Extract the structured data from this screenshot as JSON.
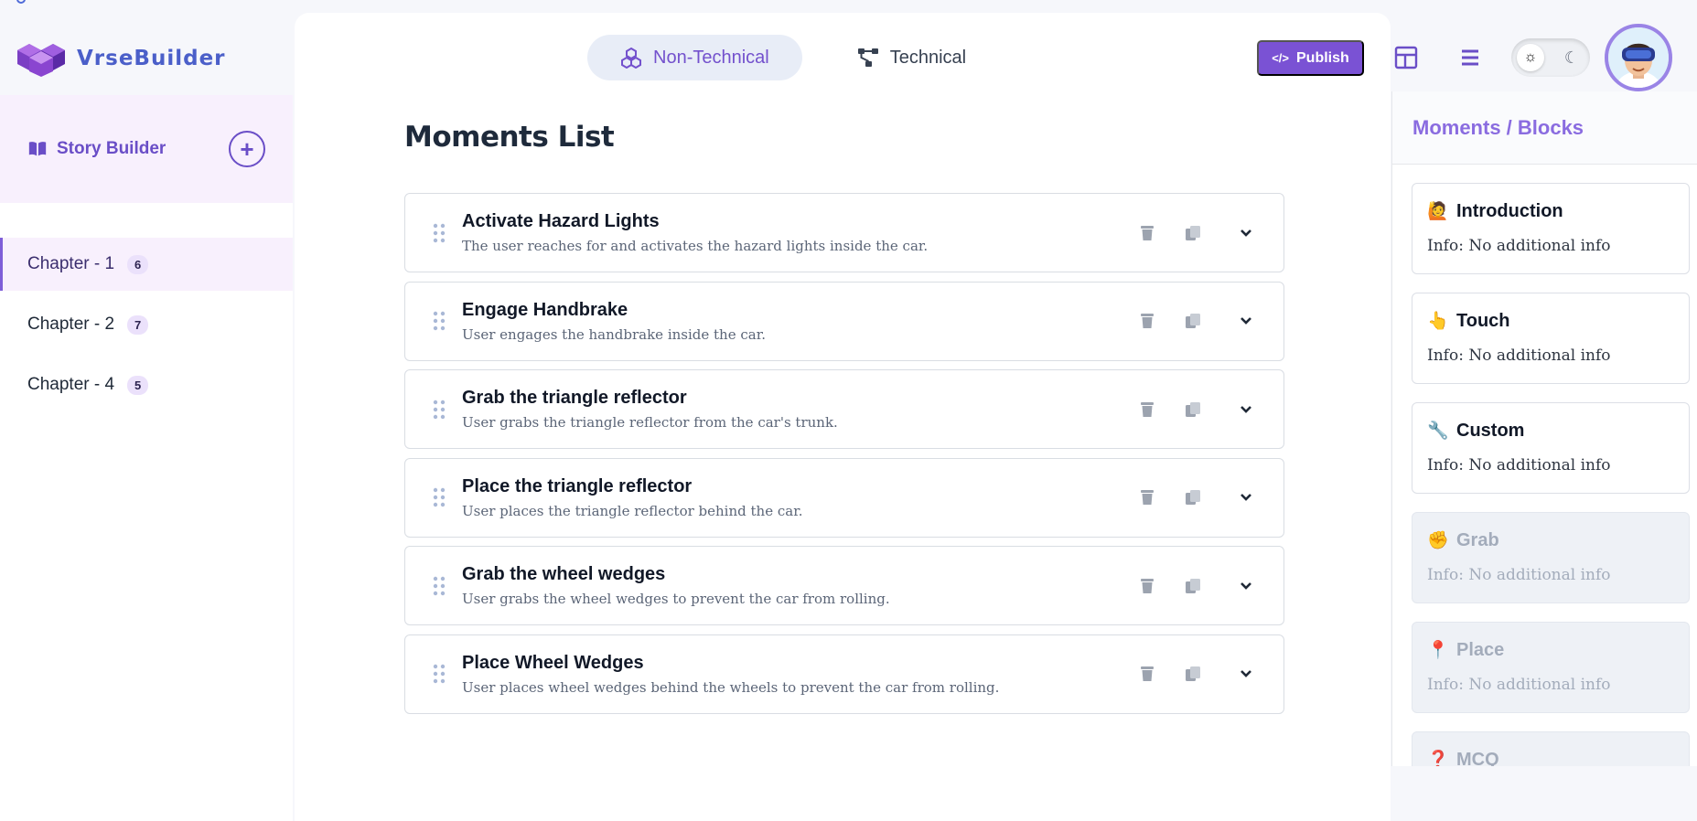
{
  "app": {
    "name": "VrseBuilder"
  },
  "sidebar": {
    "story_title": "Story Builder",
    "add_label": "+",
    "chapters": [
      {
        "label": "Chapter - 1",
        "count": "6",
        "active": true
      },
      {
        "label": "Chapter - 2",
        "count": "7",
        "active": false
      },
      {
        "label": "Chapter - 4",
        "count": "5",
        "active": false
      }
    ]
  },
  "header": {
    "modes": [
      {
        "label": "Non-Technical",
        "active": true
      },
      {
        "label": "Technical",
        "active": false
      }
    ],
    "publish_label": "Publish",
    "theme": {
      "sun": "☼",
      "moon": "☾"
    }
  },
  "main": {
    "title": "Moments List",
    "moments": [
      {
        "title": "Activate Hazard Lights",
        "desc": "The user reaches for and activates the hazard lights inside the car."
      },
      {
        "title": "Engage Handbrake",
        "desc": "User engages the handbrake inside the car."
      },
      {
        "title": "Grab the triangle reflector",
        "desc": "User grabs the triangle reflector from the car's trunk."
      },
      {
        "title": "Place the triangle reflector",
        "desc": "User places the triangle reflector behind the car."
      },
      {
        "title": "Grab the wheel wedges",
        "desc": "User grabs the wheel wedges to prevent the car from rolling."
      },
      {
        "title": "Place Wheel Wedges",
        "desc": "User places wheel wedges behind the wheels to prevent the car from rolling."
      }
    ]
  },
  "blocks": {
    "title": "Moments / Blocks",
    "items": [
      {
        "name": "Introduction",
        "emoji": "🙋",
        "info": "Info: No additional info",
        "disabled": false
      },
      {
        "name": "Touch",
        "emoji": "👆",
        "info": "Info: No additional info",
        "disabled": false
      },
      {
        "name": "Custom",
        "emoji": "🔧",
        "info": "Info: No additional info",
        "disabled": false
      },
      {
        "name": "Grab",
        "emoji": "✊",
        "info": "Info: No additional info",
        "disabled": true
      },
      {
        "name": "Place",
        "emoji": "📍",
        "info": "Info: No additional info",
        "disabled": true
      },
      {
        "name": "MCQ",
        "emoji": "❓",
        "info": "",
        "disabled": true
      }
    ]
  },
  "colors": {
    "accent": "#7a52d4",
    "brand": "#4b5fc9",
    "active_bg": "#f8f0fd"
  }
}
